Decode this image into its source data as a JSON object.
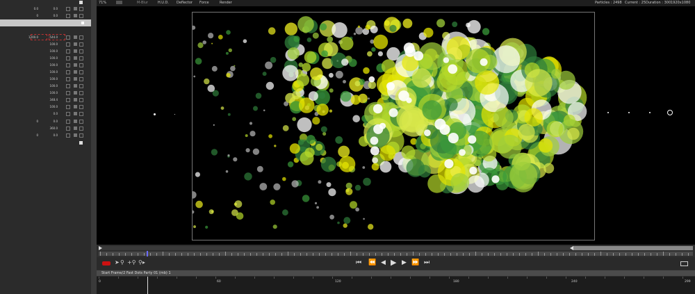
{
  "toolbar": {
    "zoom": "71%",
    "mblur": "M-Blur",
    "hud": "H.U.D.",
    "deflector": "Deflector",
    "force": "Force",
    "render": "Render",
    "particles": "Particles : 2498",
    "current": "Current : 25",
    "duration": "Duration : 300",
    "resolution": "1920x1080"
  },
  "params": {
    "rows": [
      {
        "v1": "0.0",
        "v2": "0.0"
      },
      {
        "v1": "0",
        "v2": "0.0"
      },
      {
        "v1": "",
        "v2": ""
      },
      {
        "v1": "",
        "v2": ""
      },
      {
        "v1": "1200.0",
        "v2": "-544.0"
      },
      {
        "v1": "",
        "v2": "100.0"
      },
      {
        "v1": "",
        "v2": "100.0"
      },
      {
        "v1": "",
        "v2": "100.0"
      },
      {
        "v1": "",
        "v2": "100.0"
      },
      {
        "v1": "",
        "v2": "100.0"
      },
      {
        "v1": "",
        "v2": "100.0"
      },
      {
        "v1": "",
        "v2": "100.0"
      },
      {
        "v1": "",
        "v2": "100.0"
      },
      {
        "v1": "",
        "v2": "348.4"
      },
      {
        "v1": "",
        "v2": "100.0"
      },
      {
        "v1": "",
        "v2": "0.0"
      },
      {
        "v1": "0",
        "v2": "0.0"
      },
      {
        "v1": "",
        "v2": "360.0"
      },
      {
        "v1": "0",
        "v2": "0.0"
      }
    ]
  },
  "timeline": {
    "layer_label": "Start Frame/2 Fast Dots Party 01 (mb) 1",
    "frame_labels": [
      "0",
      "60",
      "120",
      "180",
      "240",
      "299"
    ]
  },
  "colors": {
    "panel": "#2b2b2b",
    "canvas": "#000000",
    "record": "#cc1111",
    "particle_yellow": "#e6e600",
    "particle_green": "#3a9a3a",
    "particle_lime": "#b5d92a"
  }
}
